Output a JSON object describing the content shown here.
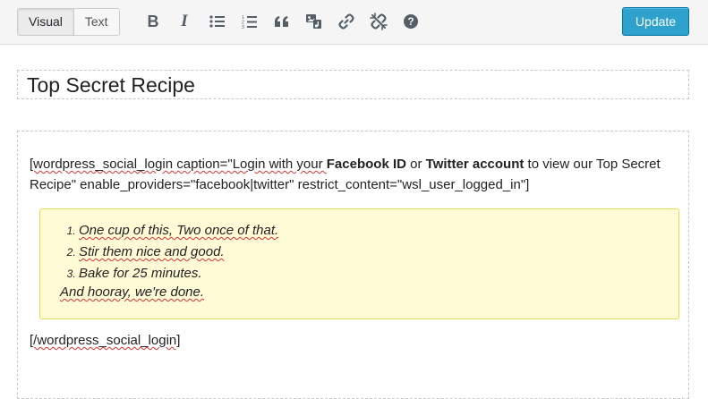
{
  "toolbar": {
    "tabs": [
      "Visual",
      "Text"
    ],
    "active_tab": "Visual",
    "icons": [
      "bold-icon",
      "italic-icon",
      "bulleted-list-icon",
      "numbered-list-icon",
      "blockquote-icon",
      "insert-media-icon",
      "insert-link-icon",
      "remove-link-icon",
      "help-icon"
    ],
    "bold_glyph": "B",
    "italic_glyph": "I",
    "help_glyph": "?",
    "update_label": "Update",
    "update_color": "#2ea2cc"
  },
  "post": {
    "title": "Top Secret Recipe",
    "shortcode_open_parts": [
      "[wordpress_social_login caption=\"Login with your ",
      "Facebook ID",
      " or ",
      "Twitter account",
      " to view our Top Secret Recipe\" enable_providers=\"facebook|twitter\" restrict_content=\"wsl_user_logged_in\"]"
    ],
    "recipe_items": [
      "One cup of this, Two once of that.",
      "Stir them nice and good.",
      "Bake for 25 minutes."
    ],
    "recipe_ending": "And hooray, we're done.",
    "shortcode_close": "[/wordpress_social_login]",
    "highlight_background": "#fffbd6"
  }
}
